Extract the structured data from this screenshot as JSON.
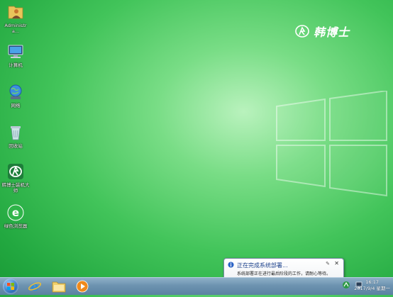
{
  "brand": {
    "text": "韩博士"
  },
  "desktop_icons": [
    {
      "label": "Administra...",
      "icon": "folder-user-icon"
    },
    {
      "label": "计算机",
      "icon": "computer-icon"
    },
    {
      "label": "网络",
      "icon": "network-icon"
    },
    {
      "label": "回收站",
      "icon": "recycle-bin-icon"
    },
    {
      "label": "韩博士装机大师",
      "icon": "hanboshi-app-icon"
    },
    {
      "label": "绿色浏览器",
      "icon": "green-browser-icon"
    }
  ],
  "notification": {
    "title": "正在完成系统部署...",
    "body": "系统部署正在进行最后阶段的工作，请耐心等待。",
    "pin_glyph": "✎",
    "close_glyph": "✕"
  },
  "taskbar": {
    "apps": [
      "start-orb-icon",
      "ie-icon",
      "explorer-icon",
      "media-player-icon"
    ],
    "clock_time": "16:17",
    "clock_date": "2017/9/4 星期一"
  },
  "colors": {
    "desktop_green": "#42c45a",
    "taskbar": "#6d93b0",
    "notify_title": "#1a3f8a"
  }
}
